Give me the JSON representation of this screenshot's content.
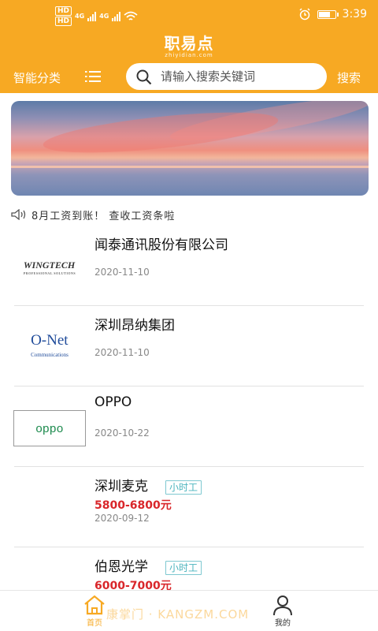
{
  "status_bar": {
    "network_left_1": "HD",
    "network_left_2": "HD",
    "signal_1": "4G",
    "signal_2": "4G",
    "time": "3:39",
    "battery_level": 0.75
  },
  "header": {
    "logo_text": "职易点",
    "logo_subtext": "zhiyidian.com",
    "category_label": "智能分类",
    "search_placeholder": "请输入搜索关键词",
    "search_button": "搜索"
  },
  "notice": {
    "text": "8月工资到账！ 查收工资条啦"
  },
  "listings": [
    {
      "company": "闻泰通讯股份有限公司",
      "date": "2020-11-10",
      "logo": "WINGTECH"
    },
    {
      "company": "深圳昂纳集团",
      "date": "2020-11-10",
      "logo": "O-Net"
    },
    {
      "company": "OPPO",
      "date": "2020-10-22",
      "logo": "oppo"
    },
    {
      "company": "深圳麦克",
      "tag": "小时工",
      "salary": "5800-6800元",
      "date": "2020-09-12"
    },
    {
      "company": "伯恩光学",
      "tag": "小时工",
      "salary": "6000-7000元"
    }
  ],
  "logo_texts": {
    "wingtech_main": "WINGTECH",
    "wingtech_sub": "PROFESSIONAL SOLUTIONS",
    "onet_main": "O-Net",
    "onet_sub": "Communications",
    "oppo": "oppo"
  },
  "tabbar": {
    "home_label": "首页",
    "me_label": "我的"
  },
  "watermark": "康掌门 · KANGZM.COM",
  "colors": {
    "brand": "#f7a923",
    "salary": "#d9262a",
    "tag": "#4ab3bd"
  }
}
